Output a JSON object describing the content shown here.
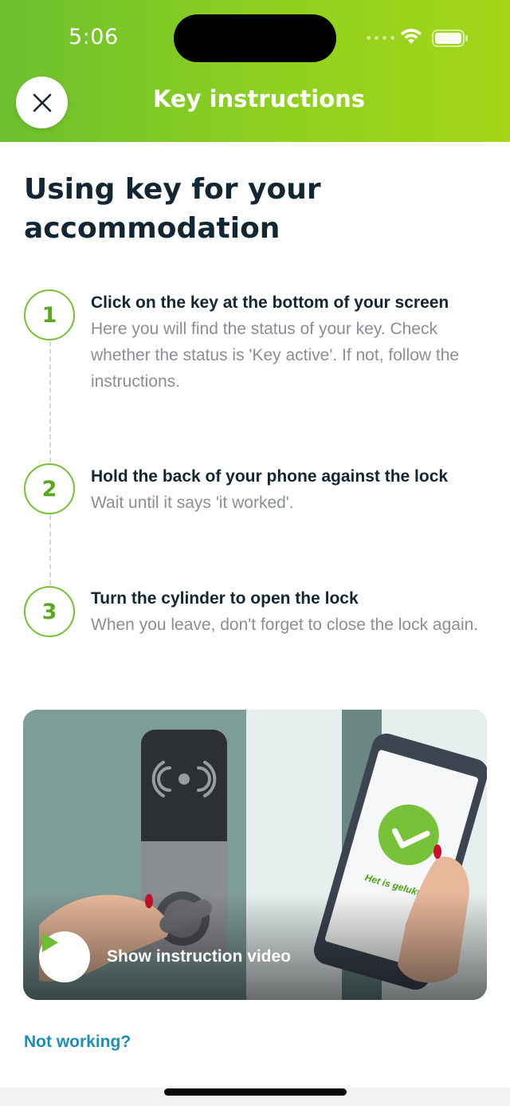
{
  "status_bar": {
    "time": "5:06"
  },
  "header": {
    "title": "Key instructions",
    "close_icon": "close-icon"
  },
  "page": {
    "title": "Using key for your accommodation"
  },
  "steps": [
    {
      "number": "1",
      "title": "Click on the key at the bottom of your screen",
      "description": "Here you will find the status of your key. Check whether the status is 'Key active'. If not, follow the instructions."
    },
    {
      "number": "2",
      "title": "Hold the back of your phone against the lock",
      "description": "Wait until it says 'it worked'."
    },
    {
      "number": "3",
      "title": "Turn the cylinder to open the lock",
      "description": "When you leave, don't forget to close the lock again."
    }
  ],
  "video": {
    "label": "Show instruction video",
    "phone_screen_text": "Het is gelukt!",
    "play_icon": "play-icon"
  },
  "footer": {
    "link": "Not working?"
  },
  "colors": {
    "brand_green": "#74c234",
    "link_blue": "#1b8fb8",
    "title_dark": "#122633"
  }
}
